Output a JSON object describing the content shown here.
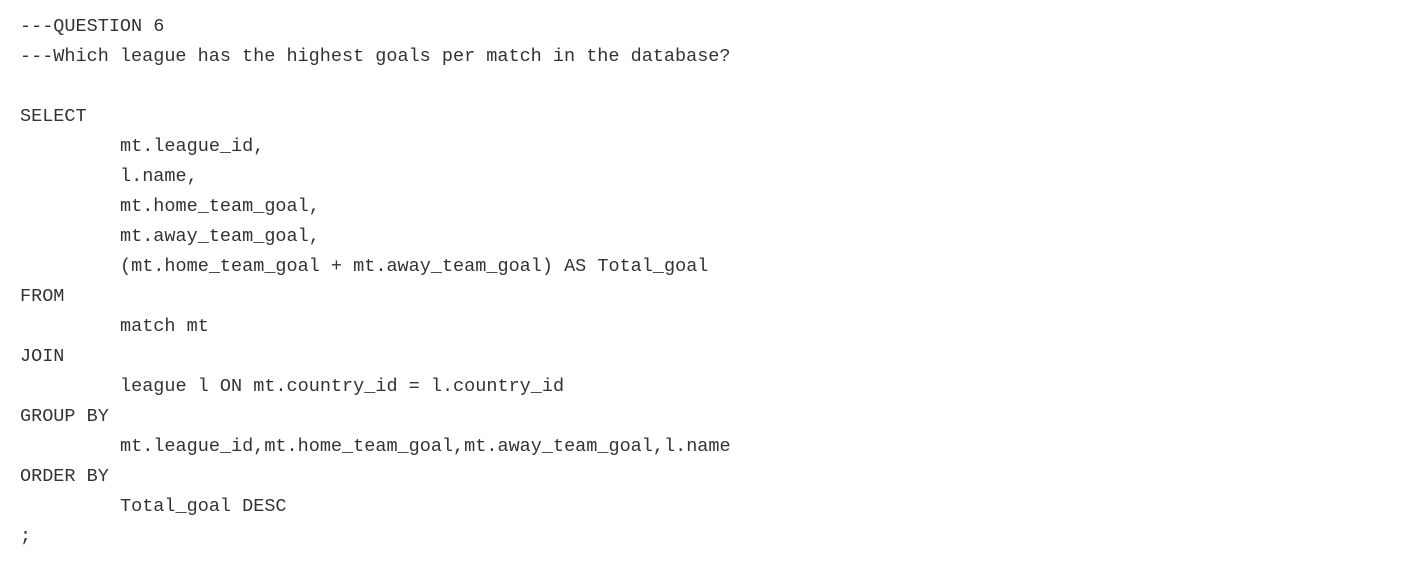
{
  "editor": {
    "lines": [
      {
        "text": "---QUESTION 6",
        "indent": false
      },
      {
        "text": "---Which league has the highest goals per match in the database?",
        "indent": false
      },
      {
        "text": "",
        "indent": false
      },
      {
        "text": "SELECT",
        "indent": false
      },
      {
        "text": "mt.league_id,",
        "indent": true
      },
      {
        "text": "l.name,",
        "indent": true
      },
      {
        "text": "mt.home_team_goal,",
        "indent": true
      },
      {
        "text": "mt.away_team_goal,",
        "indent": true
      },
      {
        "text": "(mt.home_team_goal + mt.away_team_goal) AS Total_goal",
        "indent": true
      },
      {
        "text": "FROM",
        "indent": false
      },
      {
        "text": "match mt",
        "indent": true
      },
      {
        "text": "JOIN",
        "indent": false
      },
      {
        "text": "league l ON mt.country_id = l.country_id",
        "indent": true
      },
      {
        "text": "GROUP BY",
        "indent": false
      },
      {
        "text": "mt.league_id,mt.home_team_goal,mt.away_team_goal,l.name",
        "indent": true
      },
      {
        "text": "ORDER BY",
        "indent": false
      },
      {
        "text": "Total_goal DESC",
        "indent": true
      },
      {
        "text": ";",
        "indent": false
      }
    ]
  }
}
